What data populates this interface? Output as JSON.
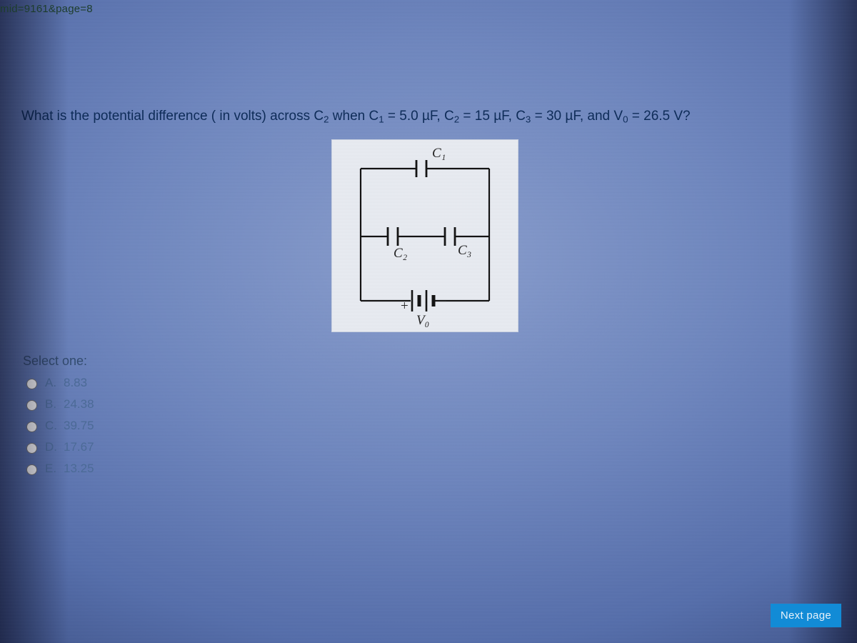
{
  "url_fragment": "mid=9161&page=8",
  "question": {
    "prefix": "What is the potential difference ( in volts) across C",
    "sub_target": "2",
    "mid": " when C",
    "c1_sub": "1",
    "c1_val": " = 5.0 µF, C",
    "c2_sub": "2",
    "c2_val": " = 15 µF, C",
    "c3_sub": "3",
    "c3_val": " = 30 µF, and V",
    "v0_sub": "0",
    "v0_val": " = 26.5 V?"
  },
  "diagram_labels": {
    "c1": "C₁",
    "c2": "C₂",
    "c3": "C₃",
    "v0": "V₀",
    "plus": "+",
    "minus": "−"
  },
  "select_one": "Select one:",
  "options": [
    {
      "letter": "A.",
      "value": "8.83"
    },
    {
      "letter": "B.",
      "value": "24.38"
    },
    {
      "letter": "C.",
      "value": "39.75"
    },
    {
      "letter": "D.",
      "value": "17.67"
    },
    {
      "letter": "E.",
      "value": "13.25"
    }
  ],
  "next_button": "Next page"
}
